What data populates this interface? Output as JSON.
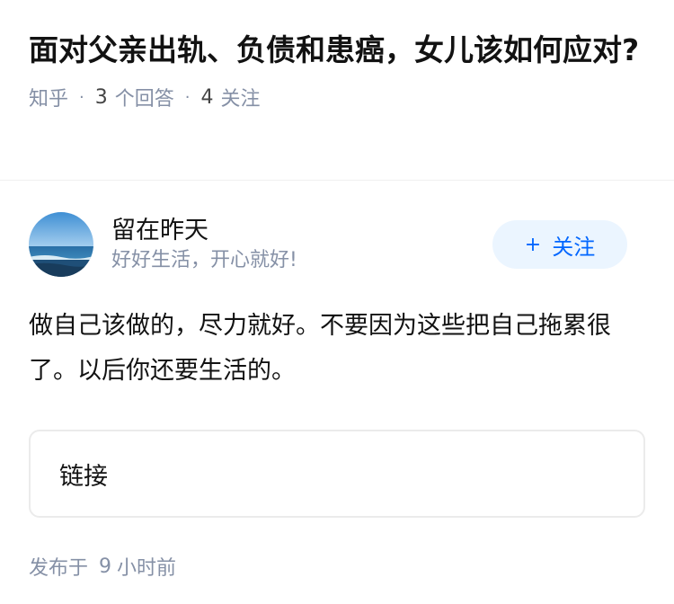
{
  "question": {
    "title": "面对父亲出轨、负债和患癌，女儿该如何应对?",
    "source": "知乎",
    "answer_count": "3",
    "answer_label": "个回答",
    "follow_count": "4",
    "follow_label": "关注",
    "separator": "·"
  },
  "answer": {
    "author": {
      "name": "留在昨天",
      "bio": "好好生活，开心就好!",
      "avatar_icon": "beach-avatar"
    },
    "follow_button": {
      "plus": "+",
      "label": "关注"
    },
    "content": "做自己该做的，尽力就好。不要因为这些把自己拖累很了。以后你还要生活的。",
    "link_card_label": "链接",
    "publish": {
      "prefix": "发布于",
      "number": "9",
      "suffix": "小时前"
    }
  },
  "colors": {
    "accent": "#0066ff",
    "accent_bg": "#ebf5ff",
    "muted": "#8590a6",
    "text": "#121212"
  }
}
